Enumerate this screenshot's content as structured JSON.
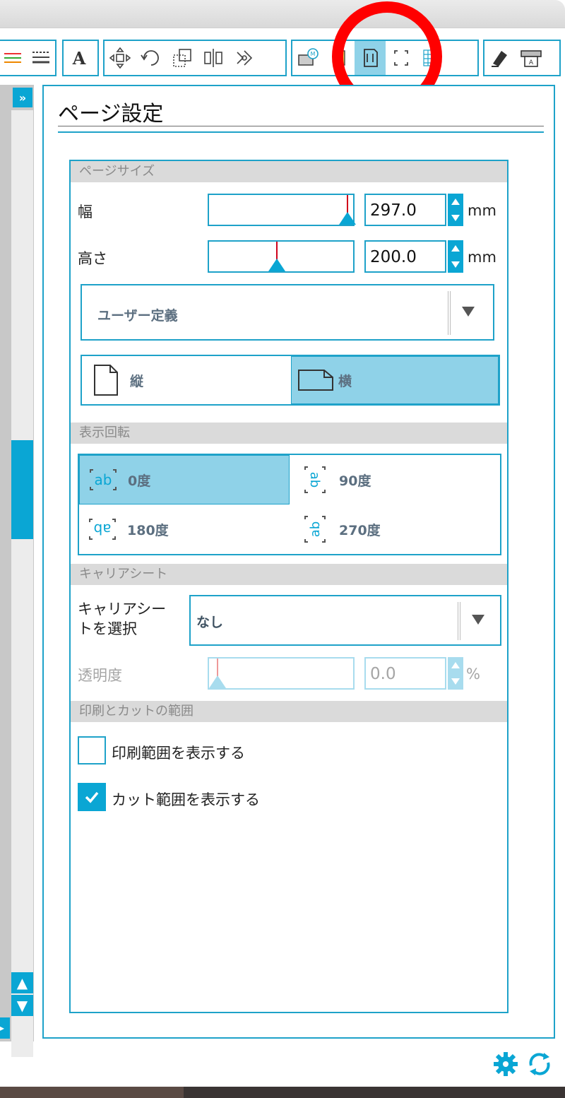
{
  "panel": {
    "title": "ページ設定"
  },
  "page_size": {
    "section_label": "ページサイズ",
    "width_label": "幅",
    "width_value": "297.0",
    "width_unit": "mm",
    "width_slider_fraction": 0.96,
    "height_label": "高さ",
    "height_value": "200.0",
    "height_unit": "mm",
    "height_slider_fraction": 0.44,
    "preset_value": "ユーザー定義",
    "orientation": {
      "portrait_label": "縦",
      "landscape_label": "横",
      "selected": "landscape"
    }
  },
  "rotation": {
    "section_label": "表示回転",
    "options": [
      {
        "label": "0度",
        "selected": true
      },
      {
        "label": "90度",
        "selected": false
      },
      {
        "label": "180度",
        "selected": false
      },
      {
        "label": "270度",
        "selected": false
      }
    ]
  },
  "carrier_sheet": {
    "section_label": "キャリアシート",
    "select_label_line1": "キャリアシー",
    "select_label_line2": "トを選択",
    "select_value": "なし",
    "opacity_label": "透明度",
    "opacity_value": "0.0",
    "opacity_unit": "%",
    "opacity_slider_fraction": 0.0
  },
  "print_cut": {
    "section_label": "印刷とカットの範囲",
    "show_print_label": "印刷範囲を表示する",
    "show_print_checked": false,
    "show_cut_label": "カット範囲を表示する",
    "show_cut_checked": true
  },
  "toolbar": {
    "active_tool": "page-setup-icon",
    "icons": [
      "fill-lines-icon",
      "line-style-icon",
      "text-icon",
      "transform-move-icon",
      "rotate-icon",
      "scale-icon",
      "align-icon",
      "replicate-icon",
      "library-icon",
      "image-icon",
      "page-setup-icon",
      "registration-marks-icon",
      "grid-icon",
      "cut-settings-icon",
      "send-icon"
    ]
  },
  "colors": {
    "accent": "#0aa6d4",
    "border": "#1ea2c9",
    "selected": "#8fd2e8",
    "annotation": "#ff0000"
  }
}
